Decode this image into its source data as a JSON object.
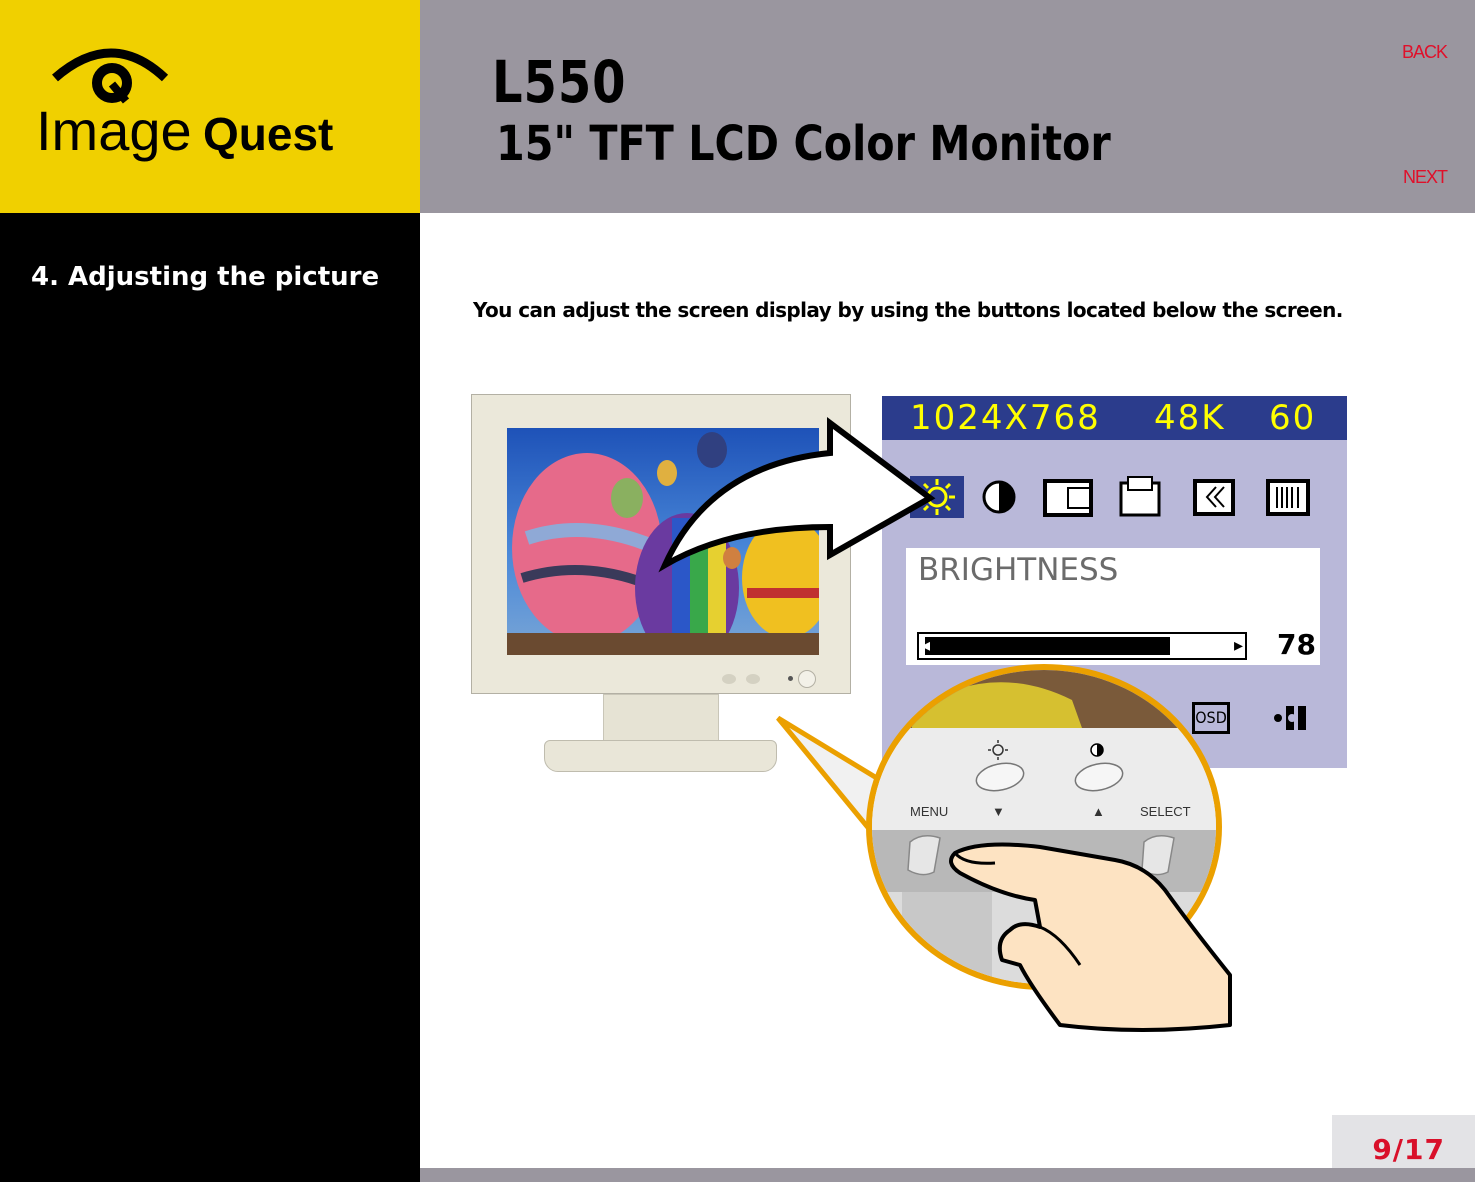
{
  "brand": {
    "logo_text_regular": "Image",
    "logo_text_bold": "Quest",
    "logo_icon": "eye-q-logo-icon"
  },
  "header": {
    "model": "L550",
    "description": "15\" TFT LCD Color Monitor",
    "back_label": "BACK",
    "next_label": "NEXT"
  },
  "sidebar": {
    "section_title": "4. Adjusting the picture"
  },
  "main": {
    "intro_text": "You can adjust the screen display by using the buttons located below the screen."
  },
  "osd": {
    "resolution": "1024X768",
    "h_freq": "48K",
    "v_freq": "60",
    "icons": [
      "brightness-icon",
      "contrast-icon",
      "h-position-icon",
      "v-position-icon",
      "phase-icon",
      "clock-icon"
    ],
    "selected_icon_index": 0,
    "setting_label": "BRIGHTNESS",
    "setting_value": "78",
    "setting_fraction": 0.78,
    "bottom_icons": [
      "osd-icon",
      "reset-icon"
    ],
    "osd_label": "OSD",
    "colors": {
      "title_bg": "#2b3c8c",
      "title_text": "#ffff00",
      "body_bg": "#b9b8d9"
    }
  },
  "button_closeup": {
    "menu_label": "MENU",
    "select_label": "SELECT",
    "down_arrow": "▼",
    "up_arrow": "▲"
  },
  "footer": {
    "page_indicator": "9/17"
  },
  "colors": {
    "logo_bg": "#f0d000",
    "header_bg": "#9a969f",
    "nav_text": "#e0102a",
    "zoom_ring": "#eba000"
  }
}
